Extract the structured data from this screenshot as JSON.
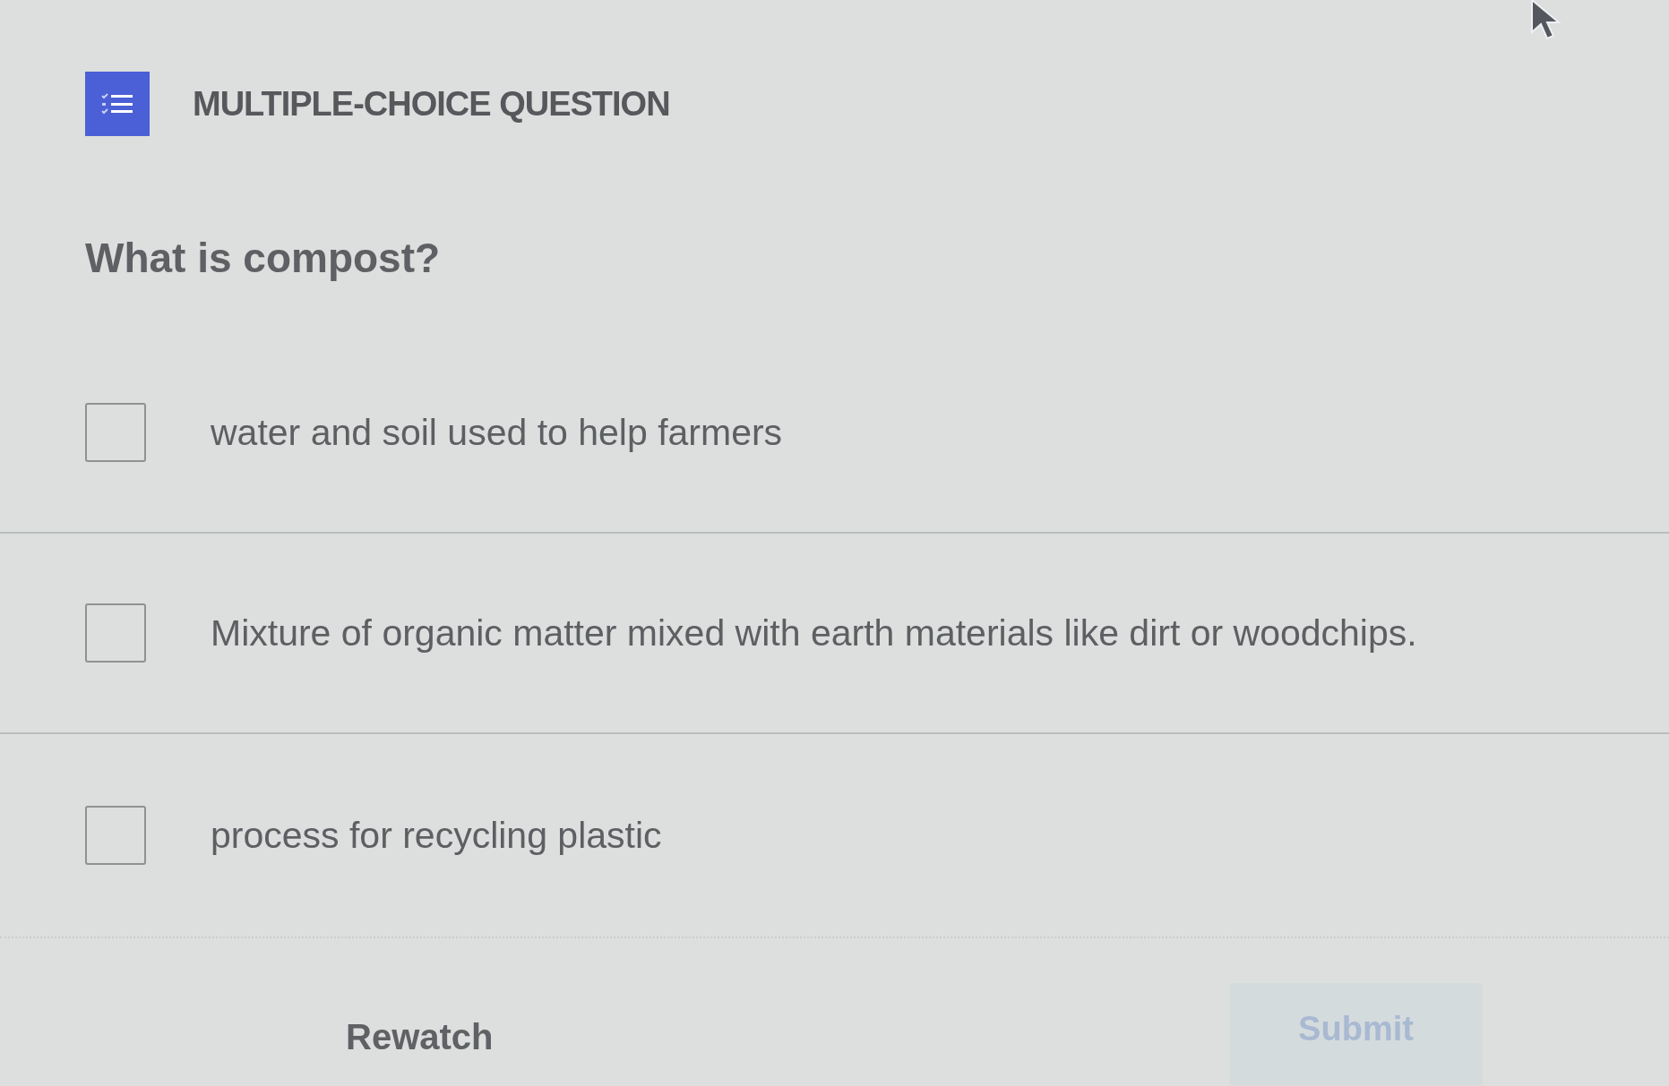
{
  "header": {
    "title": "MULTIPLE-CHOICE QUESTION"
  },
  "question": "What is compost?",
  "options": [
    {
      "label": "water and soil used to help farmers",
      "checked": false
    },
    {
      "label": "Mixture of organic matter mixed with earth materials like dirt or woodchips.",
      "checked": false
    },
    {
      "label": "process for recycling plastic",
      "checked": false
    }
  ],
  "actions": {
    "rewatch": {
      "label": "Rewatch"
    },
    "submit": {
      "label": "Submit",
      "disabled": true
    }
  }
}
